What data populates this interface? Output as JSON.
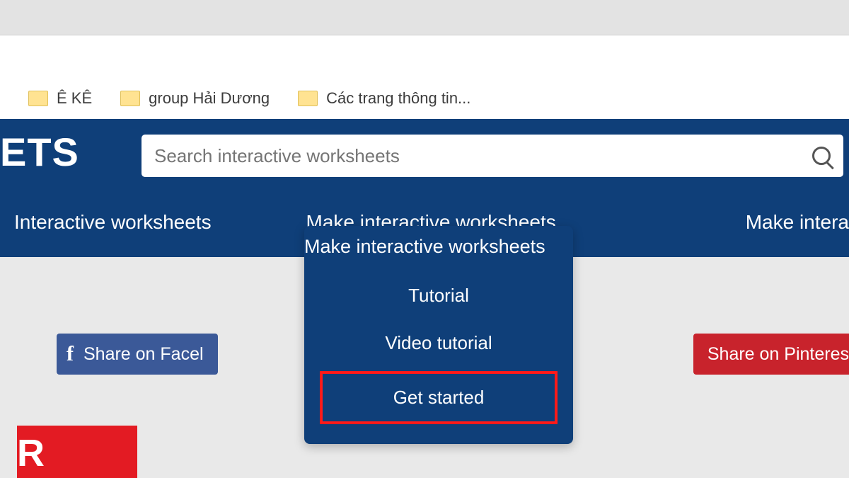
{
  "tabs": [
    {
      "favicon": "fav-red",
      "label": ""
    },
    {
      "favicon": "fav-green",
      "label": ""
    },
    {
      "favicon": "fav-orange",
      "label": ""
    },
    {
      "favicon": "fav-blue",
      "label": ""
    }
  ],
  "bookmarks": [
    {
      "label": "Ê KÊ"
    },
    {
      "label": "group Hải Dương"
    },
    {
      "label": "Các trang thông tin..."
    }
  ],
  "logo_fragment": "ETS",
  "search": {
    "placeholder": "Search interactive worksheets"
  },
  "nav": {
    "left": "Interactive worksheets",
    "center": "Make interactive worksheets",
    "right": "Make intera"
  },
  "dropdown": {
    "items": [
      "Tutorial",
      "Video tutorial",
      "Get started"
    ],
    "highlight_index": 2
  },
  "share": {
    "facebook": "Share on Facel",
    "pinterest": "Share on Pinteres"
  },
  "red_block_text": "R"
}
